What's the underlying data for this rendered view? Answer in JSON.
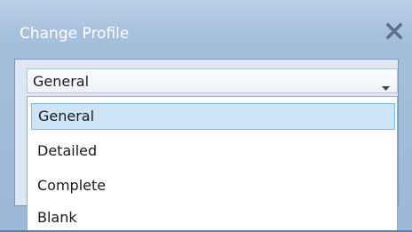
{
  "dialog": {
    "title": "Change Profile",
    "close_icon": "close-icon"
  },
  "profile_select": {
    "value": "General",
    "chevron_icon": "chevron-down-icon"
  },
  "dropdown": {
    "options": [
      {
        "label": "General",
        "selected": true
      },
      {
        "label": "Detailed",
        "selected": false
      },
      {
        "label": "Complete",
        "selected": false
      },
      {
        "label": "Blank",
        "selected": false
      }
    ]
  },
  "colors": {
    "title_bar": "#a6bfdc",
    "selected_option_bg": "#cde4f7",
    "selected_option_border": "#7db9e8"
  }
}
